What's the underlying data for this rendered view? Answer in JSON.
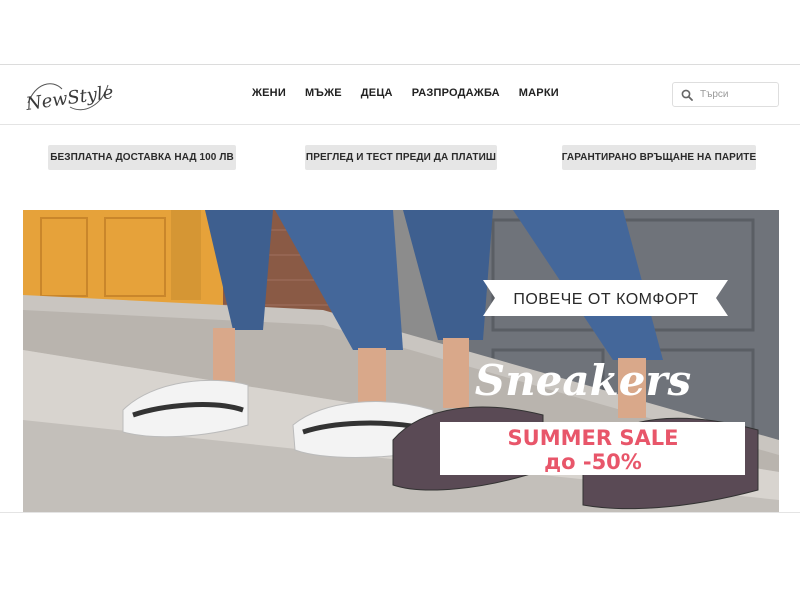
{
  "header": {
    "logo_text": "NewStyle"
  },
  "nav": {
    "items": [
      {
        "label": "ЖЕНИ"
      },
      {
        "label": "МЪЖЕ"
      },
      {
        "label": "ДЕЦА"
      },
      {
        "label": "РАЗПРОДАЖБА"
      },
      {
        "label": "МАРКИ"
      }
    ]
  },
  "search": {
    "placeholder": "Търси",
    "icon": "search-icon"
  },
  "benefits": [
    {
      "label": "БЕЗПЛАТНА ДОСТАВКА НАД 100 ЛВ"
    },
    {
      "label": "ПРЕГЛЕД И ТЕСТ ПРЕДИ ДА ПЛАТИШ"
    },
    {
      "label": "ГАРАНТИРАНО ВРЪЩАНЕ НА ПАРИТЕ"
    }
  ],
  "banner": {
    "tagline": "ПОВЕЧЕ ОТ КОМФОРТ",
    "headline": "Sneakers",
    "sale_title": "SUMMER SALE",
    "sale_discount": "до -50%",
    "colors": {
      "sale_text": "#e8566a",
      "door": "#e9a93a",
      "denim": "#3e5f8f"
    }
  }
}
